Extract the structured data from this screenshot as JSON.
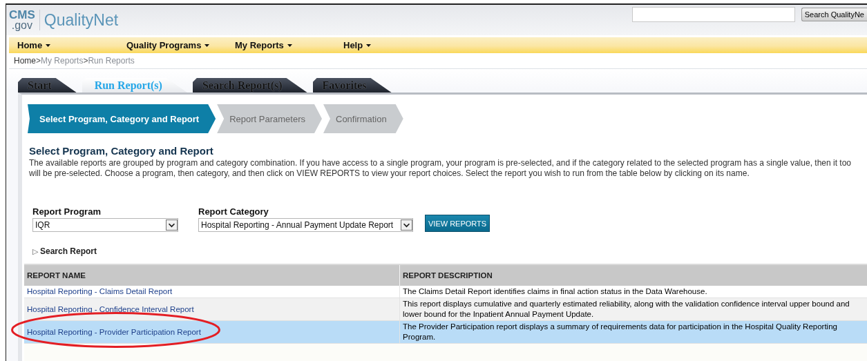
{
  "header": {
    "logo_top": "CMS",
    "logo_bottom": ".gov",
    "site_name": "QualityNet",
    "search_button": "Search QualityNe"
  },
  "nav": [
    {
      "label": "Home"
    },
    {
      "label": "Quality Programs"
    },
    {
      "label": "My Reports"
    },
    {
      "label": "Help"
    }
  ],
  "breadcrumb": {
    "separator": ">",
    "items": [
      {
        "label": "Home",
        "selected": true
      },
      {
        "label": "My Reports",
        "selected": false
      },
      {
        "label": "Run Reports",
        "selected": false
      }
    ]
  },
  "tabs": [
    {
      "label": "Start",
      "selected": false
    },
    {
      "label": "Run Report(s)",
      "selected": true
    },
    {
      "label": "Search Report(s)",
      "selected": false
    },
    {
      "label": "Favorites",
      "selected": false
    }
  ],
  "steps": [
    {
      "label": "Select Program, Category and Report",
      "selected": true
    },
    {
      "label": "Report Parameters",
      "selected": false
    },
    {
      "label": "Confirmation",
      "selected": false
    }
  ],
  "section": {
    "title": "Select Program, Category and Report",
    "description": "The available reports are grouped by program and category combination. If you have access to a single program, your program is pre-selected, and if the category related to the selected program has a single value, then it too will be pre-selected. Choose a program, then category, and then click on VIEW REPORTS to view your report choices. Select the report you wish to run from the table below by clicking on its name."
  },
  "form": {
    "program": {
      "label": "Report Program",
      "value": "IQR"
    },
    "category": {
      "label": "Report Category",
      "value": "Hospital Reporting - Annual Payment Update Report"
    },
    "button": "VIEW REPORTS"
  },
  "search_report": {
    "icon": "▷",
    "label": "Search Report",
    "expanded": false
  },
  "table": {
    "columns": [
      "REPORT NAME",
      "REPORT DESCRIPTION"
    ],
    "rows": [
      {
        "name": "Hospital Reporting - Claims Detail Report",
        "description": "The Claims Detail Report identifies claims in final action status in the Data Warehouse.",
        "selected": false
      },
      {
        "name": "Hospital Reporting - Confidence Interval Report",
        "description": "This report displays cumulative and quarterly estimated reliability, along with the validation confidence interval upper bound and lower bound for the Inpatient Annual Payment Update.",
        "selected": false
      },
      {
        "name": "Hospital Reporting - Provider Participation Report",
        "description": "The Provider Participation report displays a summary of requirements data for participation in the Hospital Quality Reporting Program.",
        "selected": true
      }
    ]
  }
}
